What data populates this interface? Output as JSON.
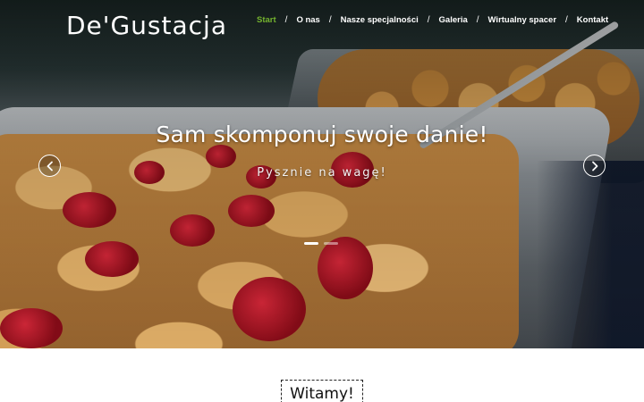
{
  "header": {
    "logo_text": "De'Gustacja",
    "nav": [
      {
        "label": "Start",
        "active": true
      },
      {
        "label": "O nas",
        "active": false
      },
      {
        "label": "Nasze specjalności",
        "active": false
      },
      {
        "label": "Galeria",
        "active": false
      },
      {
        "label": "Wirtualny spacer",
        "active": false
      },
      {
        "label": "Kontakt",
        "active": false
      }
    ],
    "separator": "/"
  },
  "slider": {
    "title": "Sam skomponuj swoje danie!",
    "subtitle": "Pysznie na wagę!",
    "slides_count": 2,
    "active_slide": 1,
    "prev_icon": "chevron-left-icon",
    "next_icon": "chevron-right-icon"
  },
  "welcome": {
    "heading": "Witamy!"
  },
  "colors": {
    "accent_active_nav": "#74b32e",
    "text_light": "#ffffff",
    "text_dark": "#111111"
  }
}
